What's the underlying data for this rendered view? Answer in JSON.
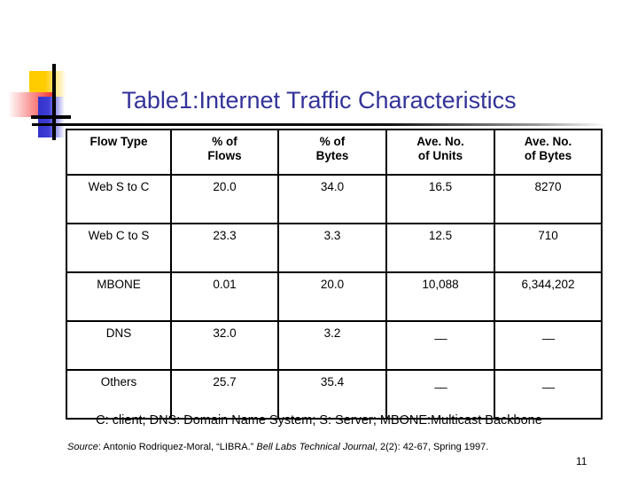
{
  "slide": {
    "title": "Table1:Internet Traffic Characteristics",
    "page_number": "11",
    "title_color": "#333399"
  },
  "decoration": {
    "yellow_color": "#FFCC00",
    "red_color": "#F03030",
    "blue_color": "#3333CC",
    "line_color": "#000000"
  },
  "table": {
    "headers": [
      "Flow Type",
      "% of\nFlows",
      "% of\nBytes",
      "Ave. No.\nof Units",
      "Ave. No.\nof Bytes"
    ],
    "headers_line1": [
      "Flow Type",
      "% of",
      "% of",
      "Ave. No.",
      "Ave. No."
    ],
    "headers_line2": [
      "",
      "Flows",
      "Bytes",
      "of Units",
      "of Bytes"
    ],
    "rows": [
      {
        "flow_type": "Web S to C",
        "pct_of_flows": "20.0",
        "pct_of_bytes": "34.0",
        "ave_no_of_units": "16.5",
        "ave_no_of_bytes": "8270"
      },
      {
        "flow_type": "Web C to S",
        "pct_of_flows": "23.3",
        "pct_of_bytes": "3.3",
        "ave_no_of_units": "12.5",
        "ave_no_of_bytes": "710"
      },
      {
        "flow_type": "MBONE",
        "pct_of_flows": "0.01",
        "pct_of_bytes": "20.0",
        "ave_no_of_units": "10,088",
        "ave_no_of_bytes": "6,344,202"
      },
      {
        "flow_type": "DNS",
        "pct_of_flows": "32.0",
        "pct_of_bytes": "3.2",
        "ave_no_of_units": "__",
        "ave_no_of_bytes": "__"
      },
      {
        "flow_type": "Others",
        "pct_of_flows": "25.7",
        "pct_of_bytes": "35.4",
        "ave_no_of_units": "__",
        "ave_no_of_bytes": "__"
      }
    ]
  },
  "legend": {
    "text": "C: client; DNS: Domain Name System; S: Server; MBONE:Multicast Backbone"
  },
  "source": {
    "label": "Source",
    "after_label": ": Antonio Rodriquez-Moral, “LIBRA.” ",
    "journal": "Bell Labs Technical Journal",
    "citation_tail": ", 2(2): 42-67, Spring 1997."
  }
}
